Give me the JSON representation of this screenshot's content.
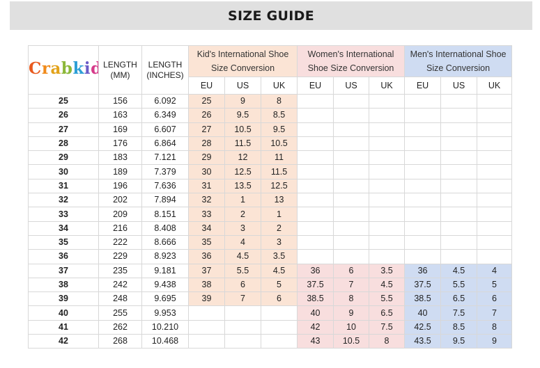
{
  "banner": {
    "title": "SIZE GUIDE"
  },
  "brand": {
    "logo_text": "Crabkids",
    "logo_colors": [
      "#e85a1f",
      "#f08a1a",
      "#e2a21a",
      "#8cb83a",
      "#2e9fd6",
      "#6a5bc7",
      "#d63a8a",
      "#e0281a"
    ]
  },
  "headers": {
    "length_mm": "LENGTH (MM)",
    "length_in": "LENGTH (INCHES)",
    "kids": "Kid's International Shoe Size Conversion",
    "women": "Women's International Shoe Size Conversion",
    "men": "Men's International Shoe Size Conversion",
    "sub": [
      "EU",
      "US",
      "UK"
    ]
  },
  "colors": {
    "kids_fill": "#fbe4d5",
    "women_fill": "#f8dede",
    "men_fill": "#cfdcf2",
    "size_text": "#e0281a",
    "banner_bg": "#e0e0e0"
  },
  "rows": [
    {
      "size": "25",
      "mm": "156",
      "inch": "6.092",
      "kid": [
        "25",
        "9",
        "8"
      ],
      "women": [
        "",
        "",
        ""
      ],
      "men": [
        "",
        "",
        ""
      ]
    },
    {
      "size": "26",
      "mm": "163",
      "inch": "6.349",
      "kid": [
        "26",
        "9.5",
        "8.5"
      ],
      "women": [
        "",
        "",
        ""
      ],
      "men": [
        "",
        "",
        ""
      ]
    },
    {
      "size": "27",
      "mm": "169",
      "inch": "6.607",
      "kid": [
        "27",
        "10.5",
        "9.5"
      ],
      "women": [
        "",
        "",
        ""
      ],
      "men": [
        "",
        "",
        ""
      ]
    },
    {
      "size": "28",
      "mm": "176",
      "inch": "6.864",
      "kid": [
        "28",
        "11.5",
        "10.5"
      ],
      "women": [
        "",
        "",
        ""
      ],
      "men": [
        "",
        "",
        ""
      ]
    },
    {
      "size": "29",
      "mm": "183",
      "inch": "7.121",
      "kid": [
        "29",
        "12",
        "11"
      ],
      "women": [
        "",
        "",
        ""
      ],
      "men": [
        "",
        "",
        ""
      ]
    },
    {
      "size": "30",
      "mm": "189",
      "inch": "7.379",
      "kid": [
        "30",
        "12.5",
        "11.5"
      ],
      "women": [
        "",
        "",
        ""
      ],
      "men": [
        "",
        "",
        ""
      ]
    },
    {
      "size": "31",
      "mm": "196",
      "inch": "7.636",
      "kid": [
        "31",
        "13.5",
        "12.5"
      ],
      "women": [
        "",
        "",
        ""
      ],
      "men": [
        "",
        "",
        ""
      ]
    },
    {
      "size": "32",
      "mm": "202",
      "inch": "7.894",
      "kid": [
        "32",
        "1",
        "13"
      ],
      "women": [
        "",
        "",
        ""
      ],
      "men": [
        "",
        "",
        ""
      ]
    },
    {
      "size": "33",
      "mm": "209",
      "inch": "8.151",
      "kid": [
        "33",
        "2",
        "1"
      ],
      "women": [
        "",
        "",
        ""
      ],
      "men": [
        "",
        "",
        ""
      ]
    },
    {
      "size": "34",
      "mm": "216",
      "inch": "8.408",
      "kid": [
        "34",
        "3",
        "2"
      ],
      "women": [
        "",
        "",
        ""
      ],
      "men": [
        "",
        "",
        ""
      ]
    },
    {
      "size": "35",
      "mm": "222",
      "inch": "8.666",
      "kid": [
        "35",
        "4",
        "3"
      ],
      "women": [
        "",
        "",
        ""
      ],
      "men": [
        "",
        "",
        ""
      ]
    },
    {
      "size": "36",
      "mm": "229",
      "inch": "8.923",
      "kid": [
        "36",
        "4.5",
        "3.5"
      ],
      "women": [
        "",
        "",
        ""
      ],
      "men": [
        "",
        "",
        ""
      ]
    },
    {
      "size": "37",
      "mm": "235",
      "inch": "9.181",
      "kid": [
        "37",
        "5.5",
        "4.5"
      ],
      "women": [
        "36",
        "6",
        "3.5"
      ],
      "men": [
        "36",
        "4.5",
        "4"
      ]
    },
    {
      "size": "38",
      "mm": "242",
      "inch": "9.438",
      "kid": [
        "38",
        "6",
        "5"
      ],
      "women": [
        "37.5",
        "7",
        "4.5"
      ],
      "men": [
        "37.5",
        "5.5",
        "5"
      ]
    },
    {
      "size": "39",
      "mm": "248",
      "inch": "9.695",
      "kid": [
        "39",
        "7",
        "6"
      ],
      "women": [
        "38.5",
        "8",
        "5.5"
      ],
      "men": [
        "38.5",
        "6.5",
        "6"
      ]
    },
    {
      "size": "40",
      "mm": "255",
      "inch": "9.953",
      "kid": [
        "",
        "",
        ""
      ],
      "women": [
        "40",
        "9",
        "6.5"
      ],
      "men": [
        "40",
        "7.5",
        "7"
      ]
    },
    {
      "size": "41",
      "mm": "262",
      "inch": "10.210",
      "kid": [
        "",
        "",
        ""
      ],
      "women": [
        "42",
        "10",
        "7.5"
      ],
      "men": [
        "42.5",
        "8.5",
        "8"
      ]
    },
    {
      "size": "42",
      "mm": "268",
      "inch": "10.468",
      "kid": [
        "",
        "",
        ""
      ],
      "women": [
        "43",
        "10.5",
        "8"
      ],
      "men": [
        "43.5",
        "9.5",
        "9"
      ]
    }
  ]
}
